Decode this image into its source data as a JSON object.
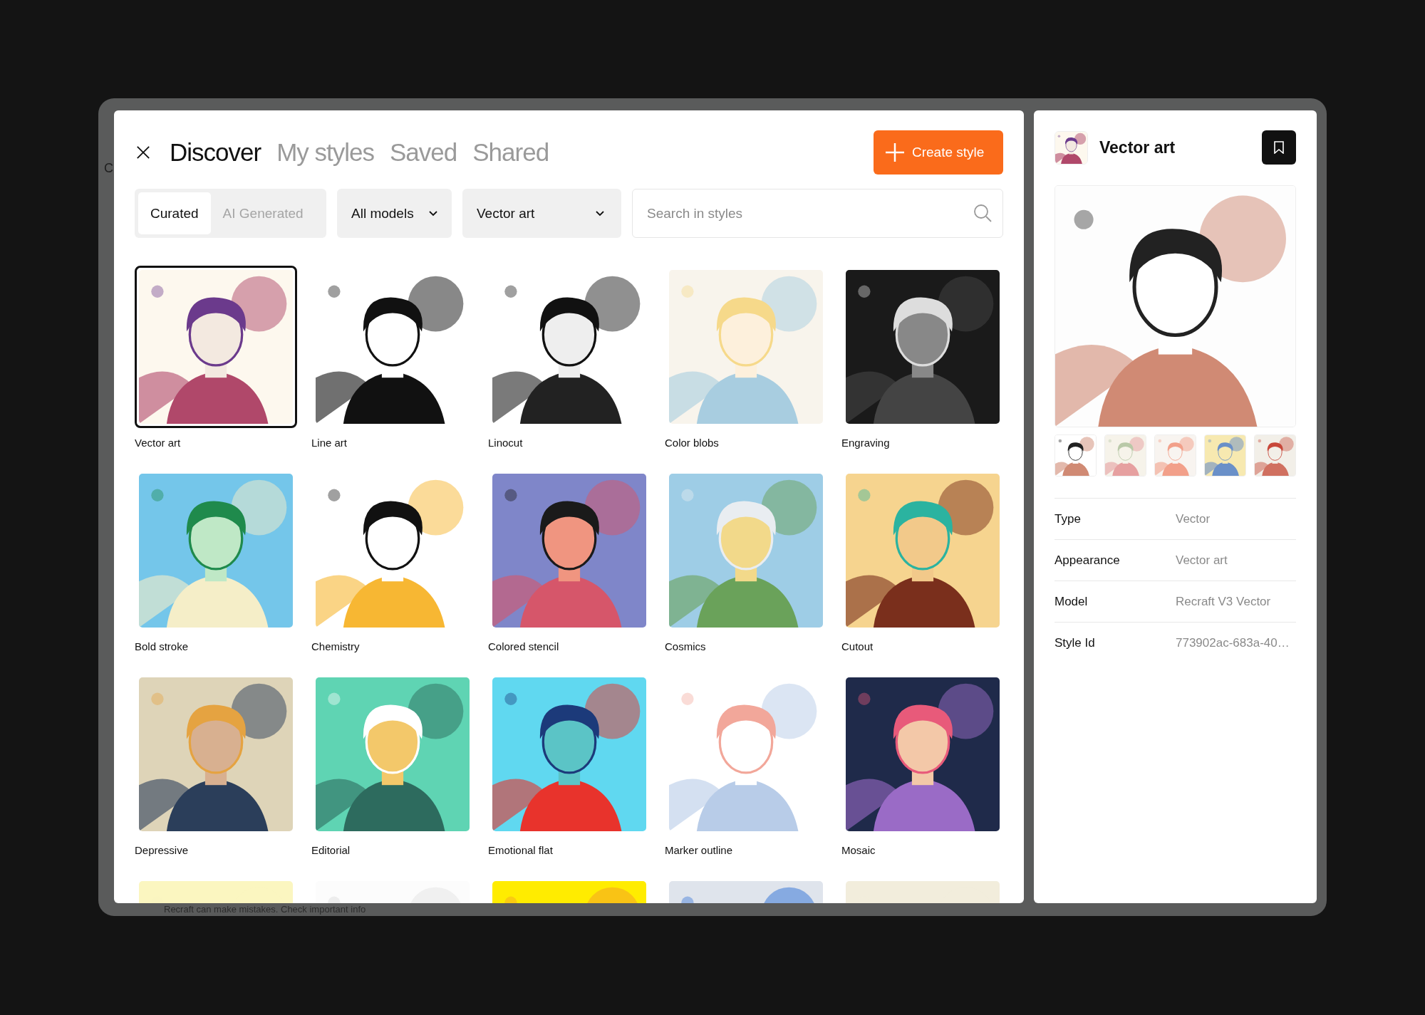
{
  "background_texts": {
    "left": "C",
    "footer": "Recraft can make mistakes. Check important info"
  },
  "tabs": [
    {
      "label": "Discover",
      "selected": true
    },
    {
      "label": "My styles",
      "selected": false
    },
    {
      "label": "Saved",
      "selected": false
    },
    {
      "label": "Shared",
      "selected": false
    }
  ],
  "create_button": "Create style",
  "source_toggle": [
    {
      "label": "Curated",
      "selected": true
    },
    {
      "label": "AI Generated",
      "selected": false
    }
  ],
  "dropdowns": [
    {
      "value": "All models"
    },
    {
      "value": "Vector art"
    }
  ],
  "search": {
    "placeholder": "Search in styles"
  },
  "styles": [
    {
      "label": "Vector art",
      "selected": true
    },
    {
      "label": "Line art",
      "selected": false
    },
    {
      "label": "Linocut",
      "selected": false
    },
    {
      "label": "Color blobs",
      "selected": false
    },
    {
      "label": "Engraving",
      "selected": false
    },
    {
      "label": "Bold stroke",
      "selected": false
    },
    {
      "label": "Chemistry",
      "selected": false
    },
    {
      "label": "Colored stencil",
      "selected": false
    },
    {
      "label": "Cosmics",
      "selected": false
    },
    {
      "label": "Cutout",
      "selected": false
    },
    {
      "label": "Depressive",
      "selected": false
    },
    {
      "label": "Editorial",
      "selected": false
    },
    {
      "label": "Emotional flat",
      "selected": false
    },
    {
      "label": "Marker outline",
      "selected": false
    },
    {
      "label": "Mosaic",
      "selected": false
    },
    {
      "selected": false
    },
    {
      "selected": false
    },
    {
      "selected": false
    },
    {
      "selected": false
    },
    {
      "selected": false
    }
  ],
  "detail": {
    "title": "Vector art",
    "details": [
      {
        "label": "Type",
        "value": "Vector"
      },
      {
        "label": "Appearance",
        "value": "Vector art"
      },
      {
        "label": "Model",
        "value": "Recraft V3 Vector"
      },
      {
        "label": "Style Id",
        "value": "773902ac-683a-40…"
      }
    ]
  }
}
